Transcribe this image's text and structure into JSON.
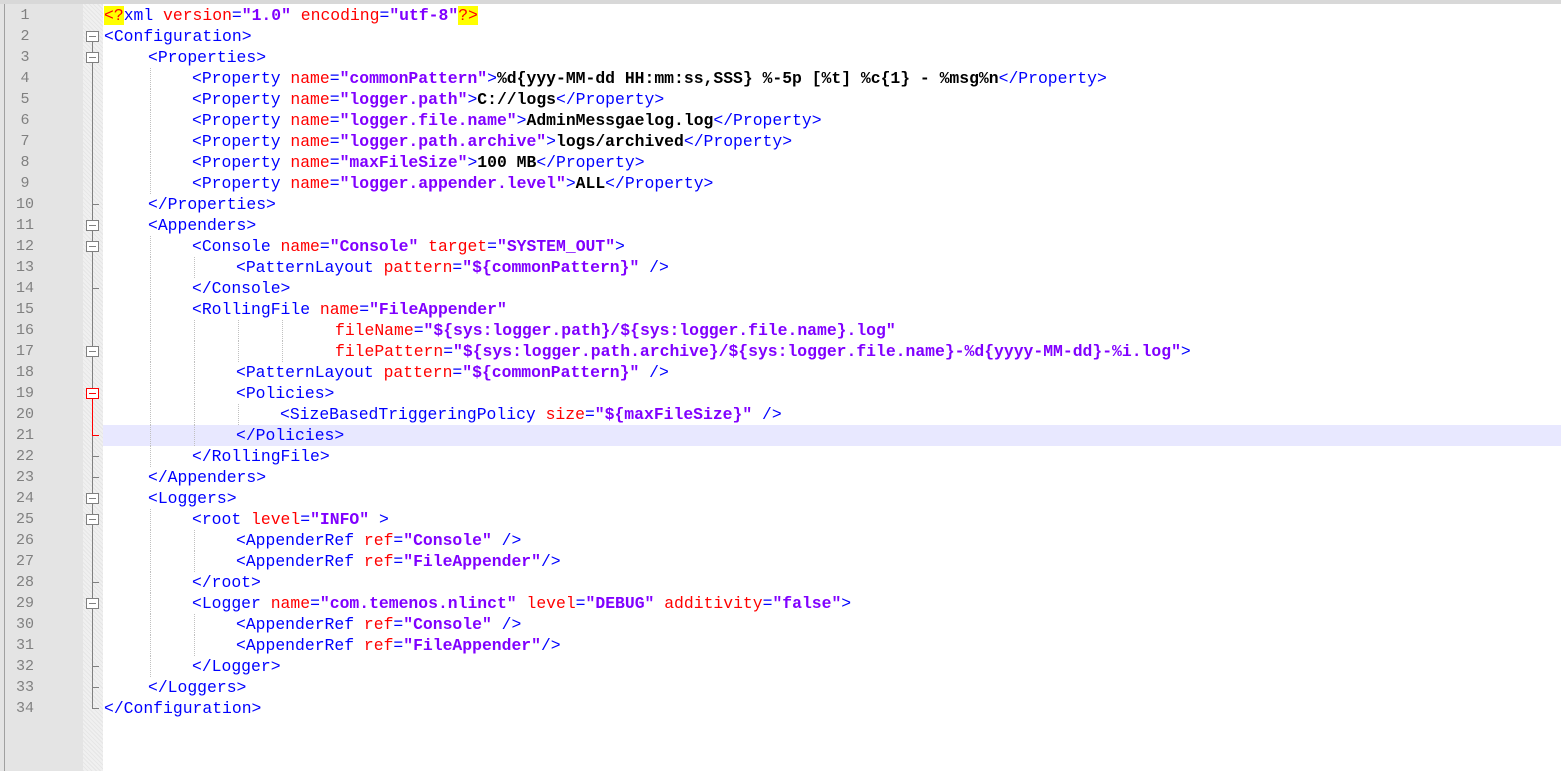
{
  "editor": {
    "current_line": 21,
    "colors": {
      "tag": "#0000ff",
      "attribute": "#ff0000",
      "value": "#8000ff",
      "text": "#000000",
      "current_line_bg": "#e8e8ff",
      "pi_bg": "#ffff00"
    },
    "lines": [
      {
        "n": "1",
        "indent": 0,
        "fold": "none",
        "guides": 0,
        "tokens": [
          {
            "t": "pi",
            "v": "<?"
          },
          {
            "t": "tag",
            "v": "xml"
          },
          {
            "t": "plain",
            "v": " "
          },
          {
            "t": "attr",
            "v": "version"
          },
          {
            "t": "tag",
            "v": "="
          },
          {
            "t": "val",
            "v": "\"1.0\""
          },
          {
            "t": "plain",
            "v": " "
          },
          {
            "t": "attr",
            "v": "encoding"
          },
          {
            "t": "tag",
            "v": "="
          },
          {
            "t": "val",
            "v": "\"utf-8\""
          },
          {
            "t": "pi",
            "v": "?>"
          }
        ]
      },
      {
        "n": "2",
        "indent": 0,
        "fold": "open",
        "guides": 0,
        "tokens": [
          {
            "t": "tag",
            "v": "<Configuration>"
          }
        ]
      },
      {
        "n": "3",
        "indent": 4,
        "fold": "open",
        "guides": 0,
        "tokens": [
          {
            "t": "tag",
            "v": "<Properties>"
          }
        ]
      },
      {
        "n": "4",
        "indent": 8,
        "fold": "line",
        "guides": 1,
        "tokens": [
          {
            "t": "tag",
            "v": "<Property"
          },
          {
            "t": "plain",
            "v": " "
          },
          {
            "t": "attr",
            "v": "name"
          },
          {
            "t": "tag",
            "v": "="
          },
          {
            "t": "val",
            "v": "\"commonPattern\""
          },
          {
            "t": "tag",
            "v": ">"
          },
          {
            "t": "text",
            "v": "%d{yyy-MM-dd HH:mm:ss,SSS} %-5p [%t] %c{1} - %msg%n"
          },
          {
            "t": "tag",
            "v": "</Property>"
          }
        ]
      },
      {
        "n": "5",
        "indent": 8,
        "fold": "line",
        "guides": 1,
        "tokens": [
          {
            "t": "tag",
            "v": "<Property"
          },
          {
            "t": "plain",
            "v": " "
          },
          {
            "t": "attr",
            "v": "name"
          },
          {
            "t": "tag",
            "v": "="
          },
          {
            "t": "val",
            "v": "\"logger.path\""
          },
          {
            "t": "tag",
            "v": ">"
          },
          {
            "t": "text",
            "v": "C://logs"
          },
          {
            "t": "tag",
            "v": "</Property>"
          }
        ]
      },
      {
        "n": "6",
        "indent": 8,
        "fold": "line",
        "guides": 1,
        "tokens": [
          {
            "t": "tag",
            "v": "<Property"
          },
          {
            "t": "plain",
            "v": " "
          },
          {
            "t": "attr",
            "v": "name"
          },
          {
            "t": "tag",
            "v": "="
          },
          {
            "t": "val",
            "v": "\"logger.file.name\""
          },
          {
            "t": "tag",
            "v": ">"
          },
          {
            "t": "text",
            "v": "AdminMessgaelog.log"
          },
          {
            "t": "tag",
            "v": "</Property>"
          }
        ]
      },
      {
        "n": "7",
        "indent": 8,
        "fold": "line",
        "guides": 1,
        "tokens": [
          {
            "t": "tag",
            "v": "<Property"
          },
          {
            "t": "plain",
            "v": " "
          },
          {
            "t": "attr",
            "v": "name"
          },
          {
            "t": "tag",
            "v": "="
          },
          {
            "t": "val",
            "v": "\"logger.path.archive\""
          },
          {
            "t": "tag",
            "v": ">"
          },
          {
            "t": "text",
            "v": "logs/archived"
          },
          {
            "t": "tag",
            "v": "</Property>"
          }
        ]
      },
      {
        "n": "8",
        "indent": 8,
        "fold": "line",
        "guides": 1,
        "tokens": [
          {
            "t": "tag",
            "v": "<Property"
          },
          {
            "t": "plain",
            "v": " "
          },
          {
            "t": "attr",
            "v": "name"
          },
          {
            "t": "tag",
            "v": "="
          },
          {
            "t": "val",
            "v": "\"maxFileSize\""
          },
          {
            "t": "tag",
            "v": ">"
          },
          {
            "t": "text",
            "v": "100 MB"
          },
          {
            "t": "tag",
            "v": "</Property>"
          }
        ]
      },
      {
        "n": "9",
        "indent": 8,
        "fold": "line",
        "guides": 1,
        "tokens": [
          {
            "t": "tag",
            "v": "<Property"
          },
          {
            "t": "plain",
            "v": " "
          },
          {
            "t": "attr",
            "v": "name"
          },
          {
            "t": "tag",
            "v": "="
          },
          {
            "t": "val",
            "v": "\"logger.appender.level\""
          },
          {
            "t": "tag",
            "v": ">"
          },
          {
            "t": "text",
            "v": "ALL"
          },
          {
            "t": "tag",
            "v": "</Property>"
          }
        ]
      },
      {
        "n": "10",
        "indent": 4,
        "fold": "end",
        "guides": 0,
        "tokens": [
          {
            "t": "tag",
            "v": "</Properties>"
          }
        ]
      },
      {
        "n": "11",
        "indent": 4,
        "fold": "open",
        "guides": 0,
        "tokens": [
          {
            "t": "tag",
            "v": "<Appenders>"
          }
        ]
      },
      {
        "n": "12",
        "indent": 8,
        "fold": "open",
        "guides": 1,
        "tokens": [
          {
            "t": "tag",
            "v": "<Console"
          },
          {
            "t": "plain",
            "v": " "
          },
          {
            "t": "attr",
            "v": "name"
          },
          {
            "t": "tag",
            "v": "="
          },
          {
            "t": "val",
            "v": "\"Console\""
          },
          {
            "t": "plain",
            "v": " "
          },
          {
            "t": "attr",
            "v": "target"
          },
          {
            "t": "tag",
            "v": "="
          },
          {
            "t": "val",
            "v": "\"SYSTEM_OUT\""
          },
          {
            "t": "tag",
            "v": ">"
          }
        ]
      },
      {
        "n": "13",
        "indent": 12,
        "fold": "line",
        "guides": 2,
        "tokens": [
          {
            "t": "tag",
            "v": "<PatternLayout"
          },
          {
            "t": "plain",
            "v": " "
          },
          {
            "t": "attr",
            "v": "pattern"
          },
          {
            "t": "tag",
            "v": "="
          },
          {
            "t": "val",
            "v": "\"${commonPattern}\""
          },
          {
            "t": "plain",
            "v": " "
          },
          {
            "t": "tag",
            "v": "/>"
          }
        ]
      },
      {
        "n": "14",
        "indent": 8,
        "fold": "end",
        "guides": 1,
        "tokens": [
          {
            "t": "tag",
            "v": "</Console>"
          }
        ]
      },
      {
        "n": "15",
        "indent": 8,
        "fold": "line",
        "guides": 1,
        "tokens": [
          {
            "t": "tag",
            "v": "<RollingFile"
          },
          {
            "t": "plain",
            "v": " "
          },
          {
            "t": "attr",
            "v": "name"
          },
          {
            "t": "tag",
            "v": "="
          },
          {
            "t": "val",
            "v": "\"FileAppender\""
          }
        ]
      },
      {
        "n": "16",
        "indent": 21,
        "fold": "line",
        "guides": 4,
        "tokens": [
          {
            "t": "attr",
            "v": "fileName"
          },
          {
            "t": "tag",
            "v": "="
          },
          {
            "t": "val",
            "v": "\"${sys:logger.path}/${sys:logger.file.name}.log\""
          }
        ]
      },
      {
        "n": "17",
        "indent": 21,
        "fold": "open",
        "guides": 4,
        "tokens": [
          {
            "t": "attr",
            "v": "filePattern"
          },
          {
            "t": "tag",
            "v": "="
          },
          {
            "t": "val",
            "v": "\"${sys:logger.path.archive}/${sys:logger.file.name}-%d{yyyy-MM-dd}-%i.log\""
          },
          {
            "t": "tag",
            "v": ">"
          }
        ]
      },
      {
        "n": "18",
        "indent": 12,
        "fold": "line",
        "guides": 2,
        "tokens": [
          {
            "t": "tag",
            "v": "<PatternLayout"
          },
          {
            "t": "plain",
            "v": " "
          },
          {
            "t": "attr",
            "v": "pattern"
          },
          {
            "t": "tag",
            "v": "="
          },
          {
            "t": "val",
            "v": "\"${commonPattern}\""
          },
          {
            "t": "plain",
            "v": " "
          },
          {
            "t": "tag",
            "v": "/>"
          }
        ]
      },
      {
        "n": "19",
        "indent": 12,
        "fold": "open-red",
        "guides": 2,
        "tokens": [
          {
            "t": "tag",
            "v": "<Policies>"
          }
        ]
      },
      {
        "n": "20",
        "indent": 16,
        "fold": "line-red",
        "guides": 3,
        "tokens": [
          {
            "t": "tag",
            "v": "<SizeBasedTriggeringPolicy"
          },
          {
            "t": "plain",
            "v": " "
          },
          {
            "t": "attr",
            "v": "size"
          },
          {
            "t": "tag",
            "v": "="
          },
          {
            "t": "val",
            "v": "\"${maxFileSize}\""
          },
          {
            "t": "plain",
            "v": " "
          },
          {
            "t": "tag",
            "v": "/>"
          }
        ]
      },
      {
        "n": "21",
        "indent": 12,
        "fold": "end-red",
        "guides": 2,
        "tokens": [
          {
            "t": "tag",
            "v": "</Policies>"
          }
        ]
      },
      {
        "n": "22",
        "indent": 8,
        "fold": "end",
        "guides": 1,
        "tokens": [
          {
            "t": "tag",
            "v": "</RollingFile>"
          }
        ]
      },
      {
        "n": "23",
        "indent": 4,
        "fold": "end",
        "guides": 0,
        "tokens": [
          {
            "t": "tag",
            "v": "</Appenders>"
          }
        ]
      },
      {
        "n": "24",
        "indent": 4,
        "fold": "open",
        "guides": 0,
        "tokens": [
          {
            "t": "tag",
            "v": "<Loggers>"
          }
        ]
      },
      {
        "n": "25",
        "indent": 8,
        "fold": "open",
        "guides": 1,
        "tokens": [
          {
            "t": "tag",
            "v": "<root"
          },
          {
            "t": "plain",
            "v": " "
          },
          {
            "t": "attr",
            "v": "level"
          },
          {
            "t": "tag",
            "v": "="
          },
          {
            "t": "val",
            "v": "\"INFO\""
          },
          {
            "t": "plain",
            "v": " "
          },
          {
            "t": "tag",
            "v": ">"
          }
        ]
      },
      {
        "n": "26",
        "indent": 12,
        "fold": "line",
        "guides": 2,
        "tokens": [
          {
            "t": "tag",
            "v": "<AppenderRef"
          },
          {
            "t": "plain",
            "v": " "
          },
          {
            "t": "attr",
            "v": "ref"
          },
          {
            "t": "tag",
            "v": "="
          },
          {
            "t": "val",
            "v": "\"Console\""
          },
          {
            "t": "plain",
            "v": " "
          },
          {
            "t": "tag",
            "v": "/>"
          }
        ]
      },
      {
        "n": "27",
        "indent": 12,
        "fold": "line",
        "guides": 2,
        "tokens": [
          {
            "t": "tag",
            "v": "<AppenderRef"
          },
          {
            "t": "plain",
            "v": " "
          },
          {
            "t": "attr",
            "v": "ref"
          },
          {
            "t": "tag",
            "v": "="
          },
          {
            "t": "val",
            "v": "\"FileAppender\""
          },
          {
            "t": "tag",
            "v": "/>"
          }
        ]
      },
      {
        "n": "28",
        "indent": 8,
        "fold": "end",
        "guides": 1,
        "tokens": [
          {
            "t": "tag",
            "v": "</root>"
          }
        ]
      },
      {
        "n": "29",
        "indent": 8,
        "fold": "open",
        "guides": 1,
        "tokens": [
          {
            "t": "tag",
            "v": "<Logger"
          },
          {
            "t": "plain",
            "v": " "
          },
          {
            "t": "attr",
            "v": "name"
          },
          {
            "t": "tag",
            "v": "="
          },
          {
            "t": "val",
            "v": "\"com.temenos.nlinct\""
          },
          {
            "t": "plain",
            "v": " "
          },
          {
            "t": "attr",
            "v": "level"
          },
          {
            "t": "tag",
            "v": "="
          },
          {
            "t": "val",
            "v": "\"DEBUG\""
          },
          {
            "t": "plain",
            "v": " "
          },
          {
            "t": "attr",
            "v": "additivity"
          },
          {
            "t": "tag",
            "v": "="
          },
          {
            "t": "val",
            "v": "\"false\""
          },
          {
            "t": "tag",
            "v": ">"
          }
        ]
      },
      {
        "n": "30",
        "indent": 12,
        "fold": "line",
        "guides": 2,
        "tokens": [
          {
            "t": "tag",
            "v": "<AppenderRef"
          },
          {
            "t": "plain",
            "v": " "
          },
          {
            "t": "attr",
            "v": "ref"
          },
          {
            "t": "tag",
            "v": "="
          },
          {
            "t": "val",
            "v": "\"Console\""
          },
          {
            "t": "plain",
            "v": " "
          },
          {
            "t": "tag",
            "v": "/>"
          }
        ]
      },
      {
        "n": "31",
        "indent": 12,
        "fold": "line",
        "guides": 2,
        "tokens": [
          {
            "t": "tag",
            "v": "<AppenderRef"
          },
          {
            "t": "plain",
            "v": " "
          },
          {
            "t": "attr",
            "v": "ref"
          },
          {
            "t": "tag",
            "v": "="
          },
          {
            "t": "val",
            "v": "\"FileAppender\""
          },
          {
            "t": "tag",
            "v": "/>"
          }
        ]
      },
      {
        "n": "32",
        "indent": 8,
        "fold": "end",
        "guides": 1,
        "tokens": [
          {
            "t": "tag",
            "v": "</Logger>"
          }
        ]
      },
      {
        "n": "33",
        "indent": 4,
        "fold": "end",
        "guides": 0,
        "tokens": [
          {
            "t": "tag",
            "v": "</Loggers>"
          }
        ]
      },
      {
        "n": "34",
        "indent": 0,
        "fold": "last",
        "guides": 0,
        "tokens": [
          {
            "t": "tag",
            "v": "</Configuration>"
          }
        ]
      }
    ]
  }
}
